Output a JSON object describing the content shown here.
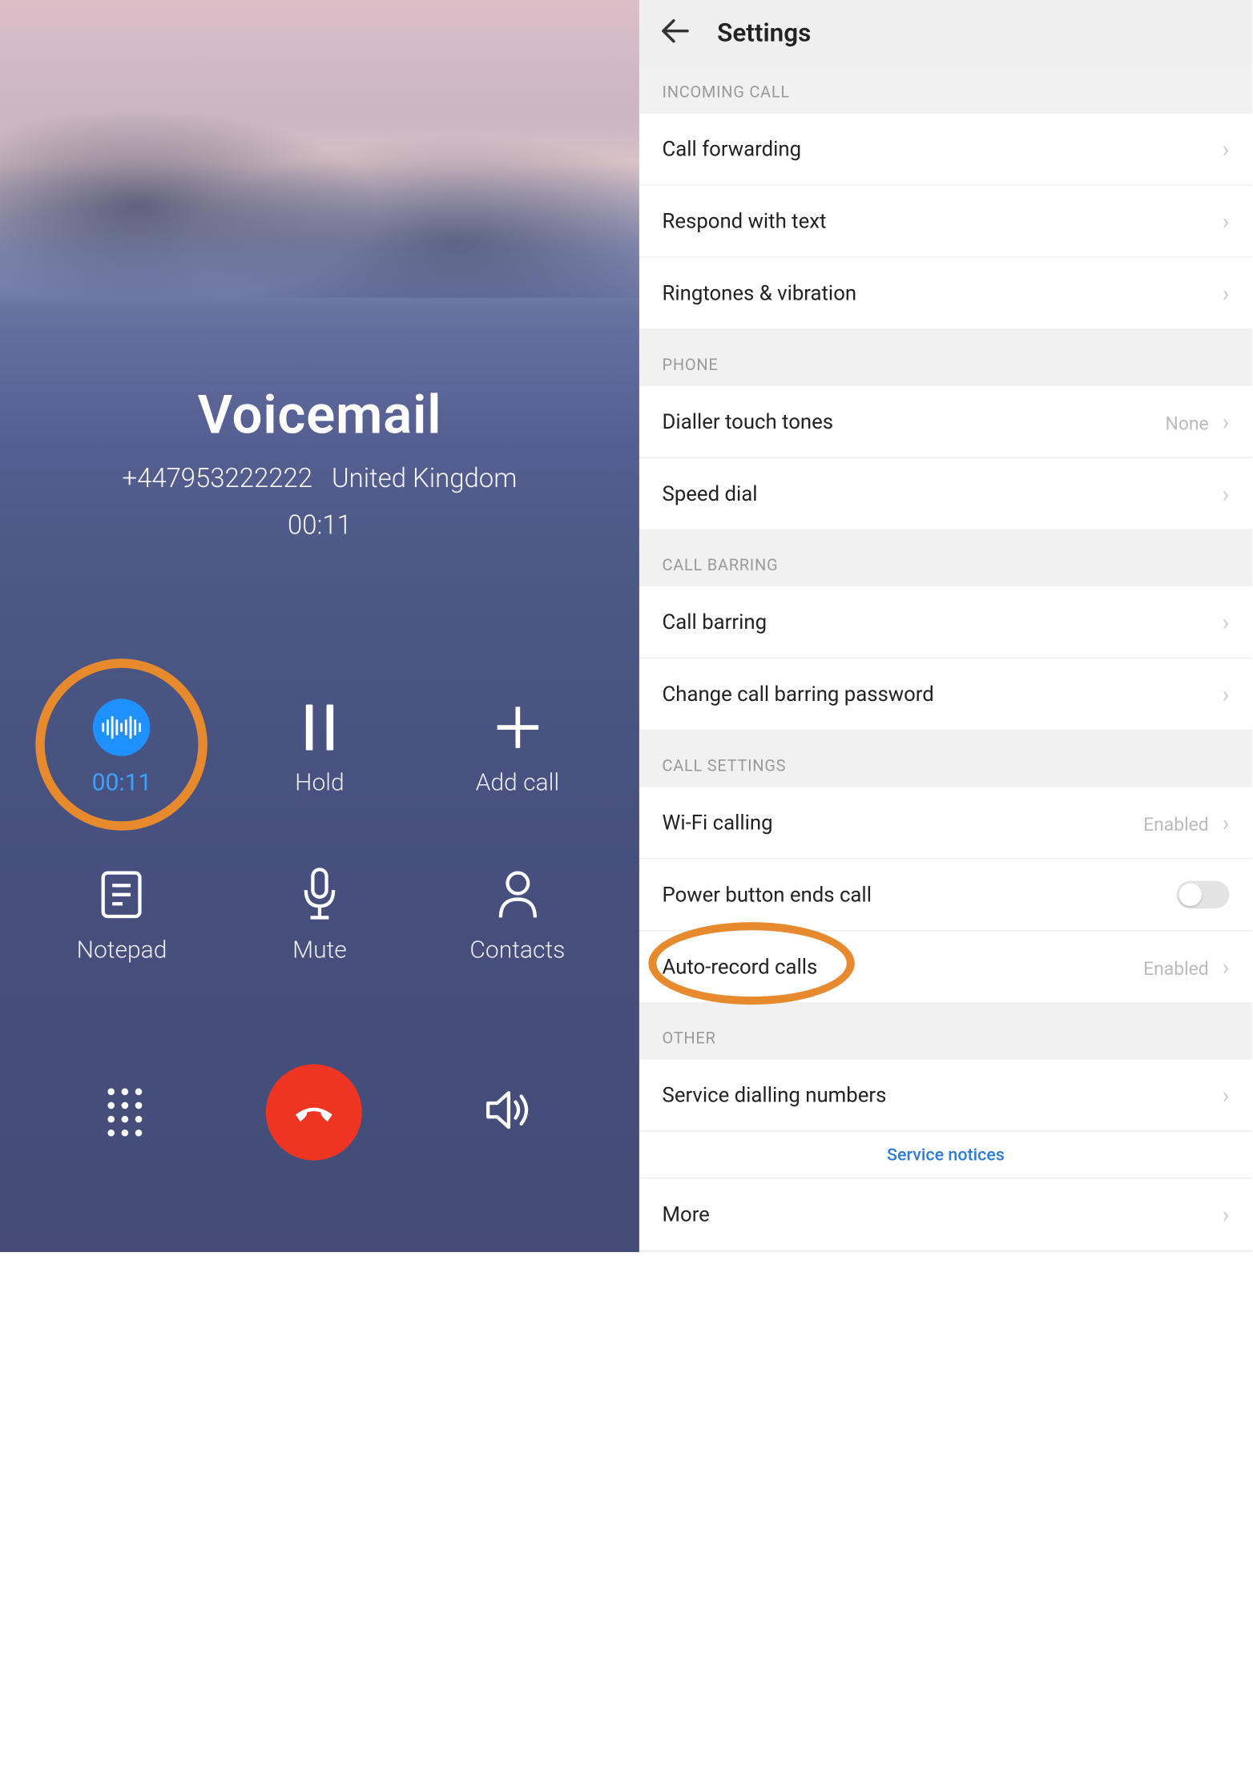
{
  "call": {
    "title": "Voicemail",
    "number": "+447953222222",
    "region": "United Kingdom",
    "duration": "00:11",
    "buttons": {
      "record_time": "00:11",
      "hold": "Hold",
      "add_call": "Add call",
      "notepad": "Notepad",
      "mute": "Mute",
      "contacts": "Contacts"
    }
  },
  "settings": {
    "title": "Settings",
    "sections": {
      "incoming_call": "INCOMING CALL",
      "phone": "PHONE",
      "call_barring": "CALL BARRING",
      "call_settings": "CALL SETTINGS",
      "other": "OTHER"
    },
    "items": {
      "call_forwarding": "Call forwarding",
      "respond_with_text": "Respond with text",
      "ringtones": "Ringtones & vibration",
      "dialler_touch_tones": "Dialler touch tones",
      "dialler_touch_tones_value": "None",
      "speed_dial": "Speed dial",
      "call_barring_item": "Call barring",
      "change_cb_password": "Change call barring password",
      "wifi_calling": "Wi-Fi calling",
      "wifi_calling_value": "Enabled",
      "power_button_ends": "Power button ends call",
      "auto_record": "Auto-record calls",
      "auto_record_value": "Enabled",
      "service_dialling": "Service dialling numbers",
      "service_notices": "Service notices",
      "more": "More"
    }
  }
}
